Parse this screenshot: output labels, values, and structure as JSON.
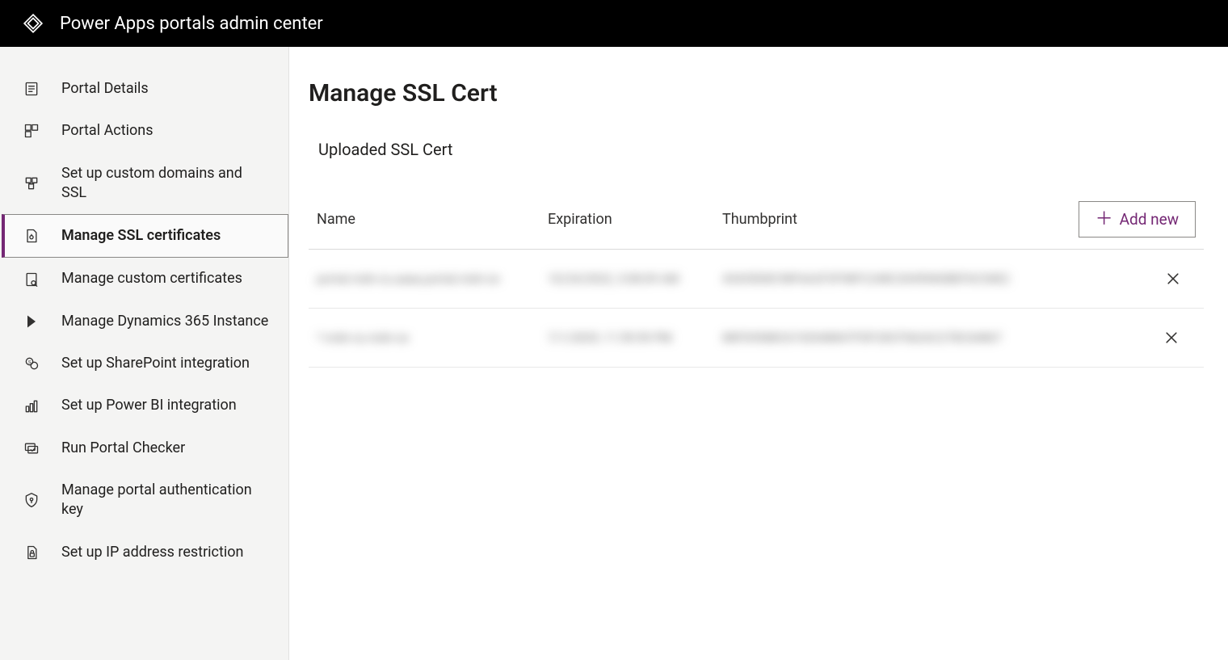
{
  "header": {
    "title": "Power Apps portals admin center"
  },
  "sidebar": {
    "items": [
      {
        "label": "Portal Details",
        "icon": "details-icon",
        "selected": false
      },
      {
        "label": "Portal Actions",
        "icon": "actions-icon",
        "selected": false
      },
      {
        "label": "Set up custom domains and SSL",
        "icon": "domains-icon",
        "selected": false
      },
      {
        "label": "Manage SSL certificates",
        "icon": "ssl-cert-icon",
        "selected": true
      },
      {
        "label": "Manage custom certificates",
        "icon": "custom-cert-icon",
        "selected": false
      },
      {
        "label": "Manage Dynamics 365 Instance",
        "icon": "dynamics-icon",
        "selected": false
      },
      {
        "label": "Set up SharePoint integration",
        "icon": "sharepoint-icon",
        "selected": false
      },
      {
        "label": "Set up Power BI integration",
        "icon": "powerbi-icon",
        "selected": false
      },
      {
        "label": "Run Portal Checker",
        "icon": "checker-icon",
        "selected": false
      },
      {
        "label": "Manage portal authentication key",
        "icon": "auth-key-icon",
        "selected": false
      },
      {
        "label": "Set up IP address restriction",
        "icon": "ip-restrict-icon",
        "selected": false
      }
    ]
  },
  "main": {
    "title": "Manage SSL Cert",
    "section_label": "Uploaded SSL Cert",
    "columns": {
      "name": "Name",
      "expiration": "Expiration",
      "thumbprint": "Thumbprint"
    },
    "add_new_label": "Add new",
    "rows": [
      {
        "name": "portal.mdn-cs.aaaa.portal.mdn-ce",
        "expiration": "10/24/2022, 3:08:09 AM",
        "thumbprint": "43435D8C98F6A2F3F98FC248C204596DBEF6C54E2"
      },
      {
        "name": "*.mdn-cs.mdn-ce",
        "expiration": "7/1/2029, 11:59:59 PM",
        "thumbprint": "88FD9588C6192048847F0FC8CF562AC278C64867"
      }
    ]
  }
}
